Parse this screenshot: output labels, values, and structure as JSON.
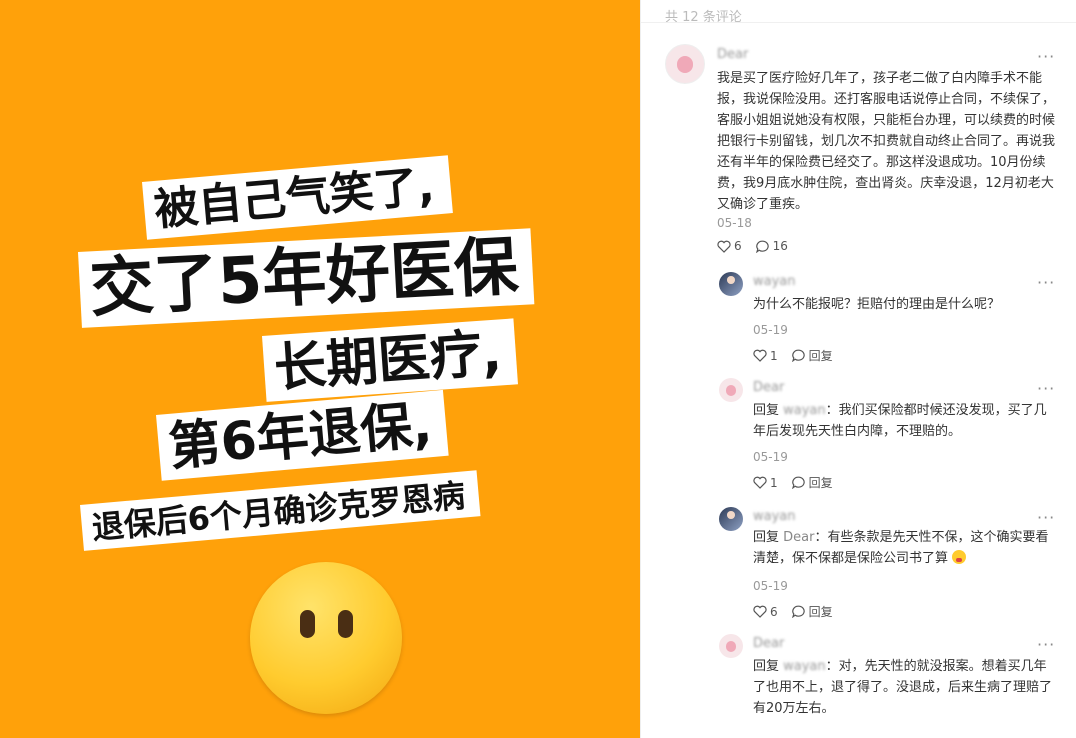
{
  "post_image": {
    "lines": [
      "被自己气笑了,",
      "交了5年好医保",
      "长期医疗,",
      "第6年退保,",
      "退保后6个月确诊克罗恩病"
    ],
    "emoji": "face-without-mouth-emoji"
  },
  "panel": {
    "header": "共 12 条评论"
  },
  "comments": [
    {
      "user": "Dear",
      "text": "我是买了医疗险好几年了，孩子老二做了白内障手术不能报，我说保险没用。还打客服电话说停止合同，不续保了，客服小姐姐说她没有权限，只能柜台办理，可以续费的时候把银行卡别留钱，划几次不扣费就自动终止合同了。再说我还有半年的保险费已经交了。那这样没退成功。10月份续费，我9月底水肿住院，查出肾炎。庆幸没退，12月初老大又确诊了重疾。",
      "date": "05-18",
      "likes": "6",
      "replies": "16"
    }
  ],
  "replies": [
    {
      "user": "wayan",
      "prefix": "",
      "reply_to": "",
      "text": "为什么不能报呢？拒赔付的理由是什么呢？",
      "date": "05-19",
      "likes": "1",
      "reply_label": "回复"
    },
    {
      "user": "Dear",
      "prefix": "回复 ",
      "reply_to": "wayan",
      "text": "：我们买保险都时候还没发现，买了几年后发现先天性白内障，不理赔的。",
      "date": "05-19",
      "likes": "1",
      "reply_label": "回复"
    },
    {
      "user": "wayan",
      "prefix": "回复 ",
      "reply_to": "Dear",
      "text": "：有些条款是先天性不保，这个确实要看清楚，保不保都是保险公司书了算",
      "date": "05-19",
      "likes": "6",
      "reply_label": "回复"
    },
    {
      "user": "Dear",
      "prefix": "回复 ",
      "reply_to": "wayan",
      "text": "：对，先天性的就没报案。想着买几年了也用不上，退了得了。没退成，后来生病了理赔了有20万左右。",
      "date": "",
      "likes": "",
      "reply_label": "回复"
    }
  ],
  "colors": {
    "background": "#FFA10A",
    "text": "#333333",
    "meta": "#999999"
  }
}
